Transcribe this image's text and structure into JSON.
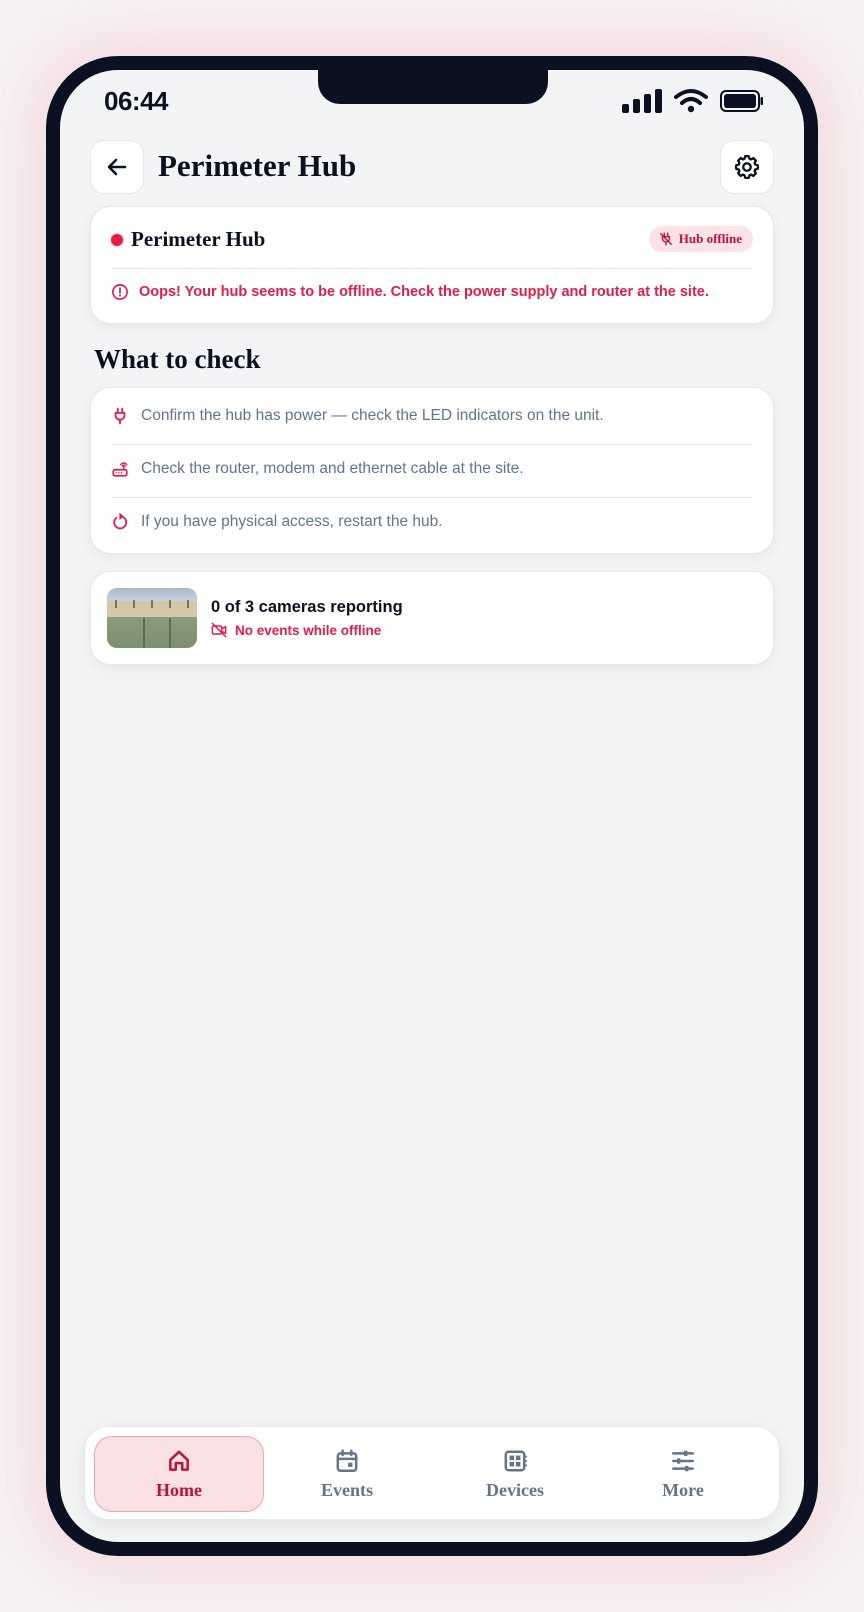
{
  "status_bar": {
    "time": "06:44"
  },
  "header": {
    "title": "Perimeter Hub"
  },
  "hub_card": {
    "name": "Perimeter Hub",
    "badge": "Hub offline",
    "alert": "Oops! Your hub seems to be offline. Check the power supply and router at the site."
  },
  "checklist": {
    "title": "What to check",
    "items": [
      {
        "icon": "plug-icon",
        "text": "Confirm the hub has power — check the LED indicators on the unit."
      },
      {
        "icon": "router-icon",
        "text": "Check the router, modem and ethernet cable at the site."
      },
      {
        "icon": "restart-icon",
        "text": "If you have physical access, restart the hub."
      }
    ]
  },
  "cameras": {
    "title": "0 of 3 cameras reporting",
    "subtitle": "No events while offline"
  },
  "tabbar": {
    "tabs": [
      {
        "label": "Home",
        "icon": "home-icon",
        "active": true
      },
      {
        "label": "Events",
        "icon": "calendar-icon",
        "active": false
      },
      {
        "label": "Devices",
        "icon": "devices-icon",
        "active": false
      },
      {
        "label": "More",
        "icon": "sliders-icon",
        "active": false
      }
    ]
  },
  "colors": {
    "accent": "#e11d48",
    "accent_dark": "#be123c",
    "accent_soft": "#fde2e7",
    "text_primary": "#0b1120",
    "text_muted": "#64748b",
    "background": "#f3f4f6"
  }
}
